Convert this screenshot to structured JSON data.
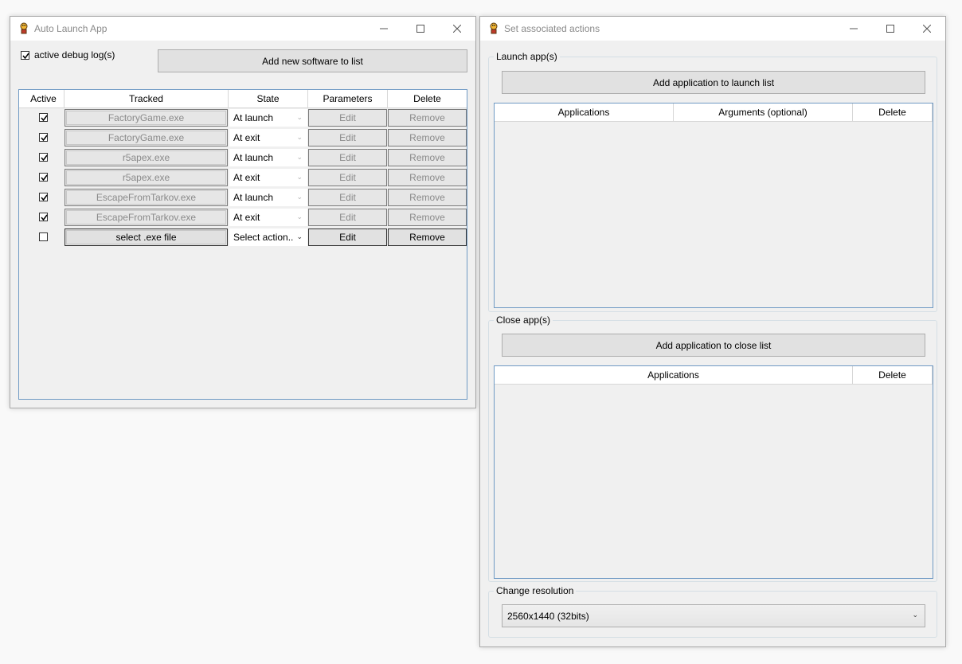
{
  "win1": {
    "title": "Auto Launch App",
    "debug_label": "active debug log(s)",
    "debug_checked": true,
    "add_button": "Add new software to list",
    "columns": [
      "Active",
      "Tracked",
      "State",
      "Parameters",
      "Delete"
    ],
    "rows": [
      {
        "active": true,
        "tracked": "FactoryGame.exe",
        "state": "At launch",
        "param": "Edit",
        "delete": "Remove",
        "enabled": false
      },
      {
        "active": true,
        "tracked": "FactoryGame.exe",
        "state": "At exit",
        "param": "Edit",
        "delete": "Remove",
        "enabled": false
      },
      {
        "active": true,
        "tracked": "r5apex.exe",
        "state": "At launch",
        "param": "Edit",
        "delete": "Remove",
        "enabled": false
      },
      {
        "active": true,
        "tracked": "r5apex.exe",
        "state": "At exit",
        "param": "Edit",
        "delete": "Remove",
        "enabled": false
      },
      {
        "active": true,
        "tracked": "EscapeFromTarkov.exe",
        "state": "At launch",
        "param": "Edit",
        "delete": "Remove",
        "enabled": false
      },
      {
        "active": true,
        "tracked": "EscapeFromTarkov.exe",
        "state": "At exit",
        "param": "Edit",
        "delete": "Remove",
        "enabled": false
      },
      {
        "active": false,
        "tracked": "select .exe file",
        "state": "Select action..",
        "param": "Edit",
        "delete": "Remove",
        "enabled": true
      }
    ]
  },
  "win2": {
    "title": "Set associated actions",
    "launch_group": "Launch app(s)",
    "launch_button": "Add application to launch list",
    "launch_columns": [
      "Applications",
      "Arguments (optional)",
      "Delete"
    ],
    "close_group": "Close app(s)",
    "close_button": "Add application to close list",
    "close_columns": [
      "Applications",
      "Delete"
    ],
    "resolution_group": "Change resolution",
    "resolution_value": "2560x1440 (32bits)"
  },
  "colors": {
    "grid_border": "#6f9ac4",
    "window_bg": "#f0f0f0",
    "disabled_text": "#8a8a8a"
  }
}
